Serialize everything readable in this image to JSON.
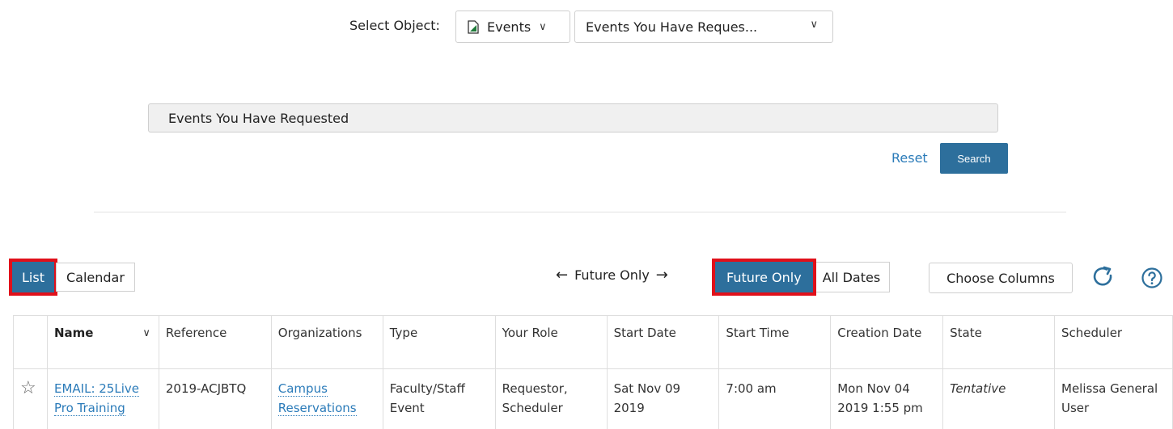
{
  "selector": {
    "label": "Select Object:",
    "object_value": "Events",
    "saved_search_value": "Events You Have Reques..."
  },
  "search": {
    "field_value": "Events You Have Requested",
    "reset_label": "Reset",
    "search_label": "Search"
  },
  "view_toggle": {
    "list_label": "List",
    "calendar_label": "Calendar"
  },
  "date_nav": {
    "label": "Future Only",
    "future_only_label": "Future Only",
    "all_dates_label": "All Dates"
  },
  "toolbar": {
    "choose_columns_label": "Choose Columns"
  },
  "table": {
    "columns": [
      "Name",
      "Reference",
      "Organizations",
      "Type",
      "Your Role",
      "Start Date",
      "Start Time",
      "Creation Date",
      "State",
      "Scheduler"
    ],
    "rows": [
      {
        "name": "EMAIL: 25Live Pro Training",
        "reference": "2019-ACJBTQ",
        "organization": "Campus Reservations",
        "type": "Faculty/Staff Event",
        "role": "Requestor, Scheduler",
        "start_date": "Sat Nov 09 2019",
        "start_time": "7:00 am",
        "creation_date": "Mon Nov 04 2019 1:55 pm",
        "state": "Tentative",
        "scheduler": "Melissa General User"
      }
    ]
  },
  "colors": {
    "accent": "#2d6f9c",
    "link": "#2b7bb9",
    "highlight_border": "#e0101a"
  }
}
